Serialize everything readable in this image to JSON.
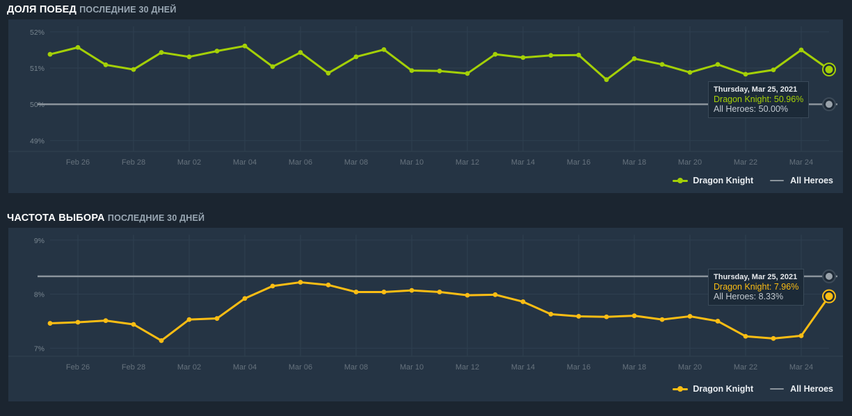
{
  "page": {
    "background": "#1b2530",
    "panel_background": "#253444"
  },
  "panels": [
    {
      "id": "winrate",
      "title": "ДОЛЯ ПОБЕД",
      "subtitle": "ПОСЛЕДНИЕ 30 ДНЕЙ",
      "accent": "#a4d007",
      "reference_color": "#8b949c",
      "tooltip": {
        "date": "Thursday, Mar 25, 2021",
        "hero_label": "Dragon Knight:",
        "hero_value": "50.96%",
        "all_label": "All Heroes:",
        "all_value": "50.00%"
      },
      "legend": [
        {
          "label": "Dragon Knight",
          "color": "#a4d007",
          "marker": true
        },
        {
          "label": "All Heroes",
          "color": "#8b949c",
          "marker": false
        }
      ],
      "chart_data": {
        "type": "line",
        "title": "ДОЛЯ ПОБЕД",
        "subtitle": "ПОСЛЕДНИЕ 30 ДНЕЙ",
        "xlabel": "",
        "ylabel": "",
        "ylim": [
          48.7,
          52.15
        ],
        "ytick_values": [
          52,
          51,
          50,
          49
        ],
        "ytick_labels": [
          "52%",
          "51%",
          "50%",
          "49%"
        ],
        "grid": true,
        "legend_position": "bottom-right",
        "x": [
          "Feb 25",
          "Feb 26",
          "Feb 27",
          "Feb 28",
          "Mar 01",
          "Mar 02",
          "Mar 03",
          "Mar 04",
          "Mar 05",
          "Mar 06",
          "Mar 07",
          "Mar 08",
          "Mar 09",
          "Mar 10",
          "Mar 11",
          "Mar 12",
          "Mar 13",
          "Mar 14",
          "Mar 15",
          "Mar 16",
          "Mar 17",
          "Mar 18",
          "Mar 19",
          "Mar 20",
          "Mar 21",
          "Mar 22",
          "Mar 23",
          "Mar 24",
          "Mar 25"
        ],
        "xtick_labels": [
          "Feb 26",
          "Feb 28",
          "Mar 02",
          "Mar 04",
          "Mar 06",
          "Mar 08",
          "Mar 10",
          "Mar 12",
          "Mar 14",
          "Mar 16",
          "Mar 18",
          "Mar 20",
          "Mar 22",
          "Mar 24"
        ],
        "series": [
          {
            "name": "Dragon Knight",
            "color": "#a4d007",
            "values": [
              51.38,
              51.57,
              51.09,
              50.96,
              51.43,
              51.31,
              51.47,
              51.61,
              51.04,
              51.43,
              50.86,
              51.31,
              51.51,
              50.93,
              50.92,
              50.85,
              51.38,
              51.29,
              51.35,
              51.36,
              50.68,
              51.26,
              51.1,
              50.88,
              51.1,
              50.83,
              50.95,
              51.5,
              50.96
            ]
          },
          {
            "name": "All Heroes",
            "color": "#8b949c",
            "constant": 50.0
          }
        ],
        "highlight": {
          "x": "Mar 25",
          "hero": 50.96,
          "all": 50.0
        }
      }
    },
    {
      "id": "pickrate",
      "title": "ЧАСТОТА ВЫБОРА",
      "subtitle": "ПОСЛЕДНИЕ 30 ДНЕЙ",
      "accent": "#fbbd14",
      "reference_color": "#8b949c",
      "tooltip": {
        "date": "Thursday, Mar 25, 2021",
        "hero_label": "Dragon Knight:",
        "hero_value": "7.96%",
        "all_label": "All Heroes:",
        "all_value": "8.33%"
      },
      "legend": [
        {
          "label": "Dragon Knight",
          "color": "#fbbd14",
          "marker": true
        },
        {
          "label": "All Heroes",
          "color": "#8b949c",
          "marker": false
        }
      ],
      "chart_data": {
        "type": "line",
        "title": "ЧАСТОТА ВЫБОРА",
        "subtitle": "ПОСЛЕДНИЕ 30 ДНЕЙ",
        "xlabel": "",
        "ylabel": "",
        "ylim": [
          6.85,
          9.1
        ],
        "ytick_values": [
          9,
          8,
          7
        ],
        "ytick_labels": [
          "9%",
          "8%",
          "7%"
        ],
        "grid": true,
        "legend_position": "bottom-right",
        "x": [
          "Feb 25",
          "Feb 26",
          "Feb 27",
          "Feb 28",
          "Mar 01",
          "Mar 02",
          "Mar 03",
          "Mar 04",
          "Mar 05",
          "Mar 06",
          "Mar 07",
          "Mar 08",
          "Mar 09",
          "Mar 10",
          "Mar 11",
          "Mar 12",
          "Mar 13",
          "Mar 14",
          "Mar 15",
          "Mar 16",
          "Mar 17",
          "Mar 18",
          "Mar 19",
          "Mar 20",
          "Mar 21",
          "Mar 22",
          "Mar 23",
          "Mar 24",
          "Mar 25"
        ],
        "xtick_labels": [
          "Feb 26",
          "Feb 28",
          "Mar 02",
          "Mar 04",
          "Mar 06",
          "Mar 08",
          "Mar 10",
          "Mar 12",
          "Mar 14",
          "Mar 16",
          "Mar 18",
          "Mar 20",
          "Mar 22",
          "Mar 24"
        ],
        "series": [
          {
            "name": "Dragon Knight",
            "color": "#fbbd14",
            "values": [
              7.46,
              7.48,
              7.51,
              7.44,
              7.14,
              7.53,
              7.55,
              7.92,
              8.15,
              8.22,
              8.17,
              8.04,
              8.04,
              8.07,
              8.04,
              7.98,
              7.99,
              7.86,
              7.63,
              7.59,
              7.58,
              7.6,
              7.53,
              7.59,
              7.5,
              7.22,
              7.18,
              7.23,
              7.96
            ]
          },
          {
            "name": "All Heroes",
            "color": "#8b949c",
            "constant": 8.33
          }
        ],
        "highlight": {
          "x": "Mar 25",
          "hero": 7.96,
          "all": 8.33
        }
      }
    }
  ]
}
